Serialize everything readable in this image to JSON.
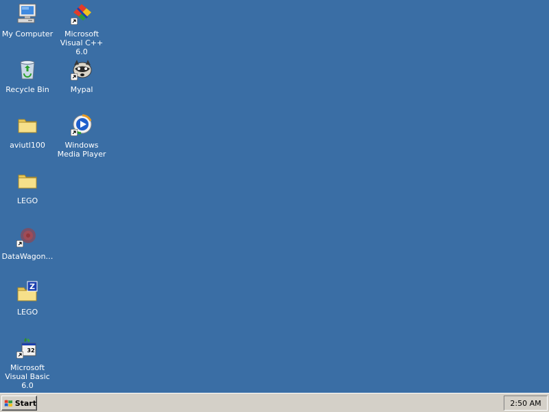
{
  "desktop": {
    "background_color": "#3a6ea5",
    "icons": [
      {
        "label": "My Computer",
        "icon": "my-computer-icon"
      },
      {
        "label": "Microsoft Visual C++ 6.0",
        "icon": "visual-cpp-icon",
        "shortcut": true
      },
      {
        "label": "Recycle Bin",
        "icon": "recycle-bin-icon"
      },
      {
        "label": "Mypal",
        "icon": "mypal-icon",
        "shortcut": true
      },
      {
        "label": "aviutl100",
        "icon": "folder-icon"
      },
      {
        "label": "Windows Media Player",
        "icon": "windows-media-player-icon",
        "shortcut": true
      },
      {
        "label": "LEGO",
        "icon": "folder-icon"
      },
      {
        "label": "DataWagon…",
        "icon": "datawagon-icon",
        "shortcut": true
      },
      {
        "label": "LEGO",
        "icon": "zip-folder-icon"
      },
      {
        "label": "Microsoft Visual Basic 6.0",
        "icon": "visual-basic-icon",
        "shortcut": true
      }
    ]
  },
  "taskbar": {
    "start_label": "Start",
    "clock": "2:50 AM",
    "background_color": "#d4d0c8"
  }
}
